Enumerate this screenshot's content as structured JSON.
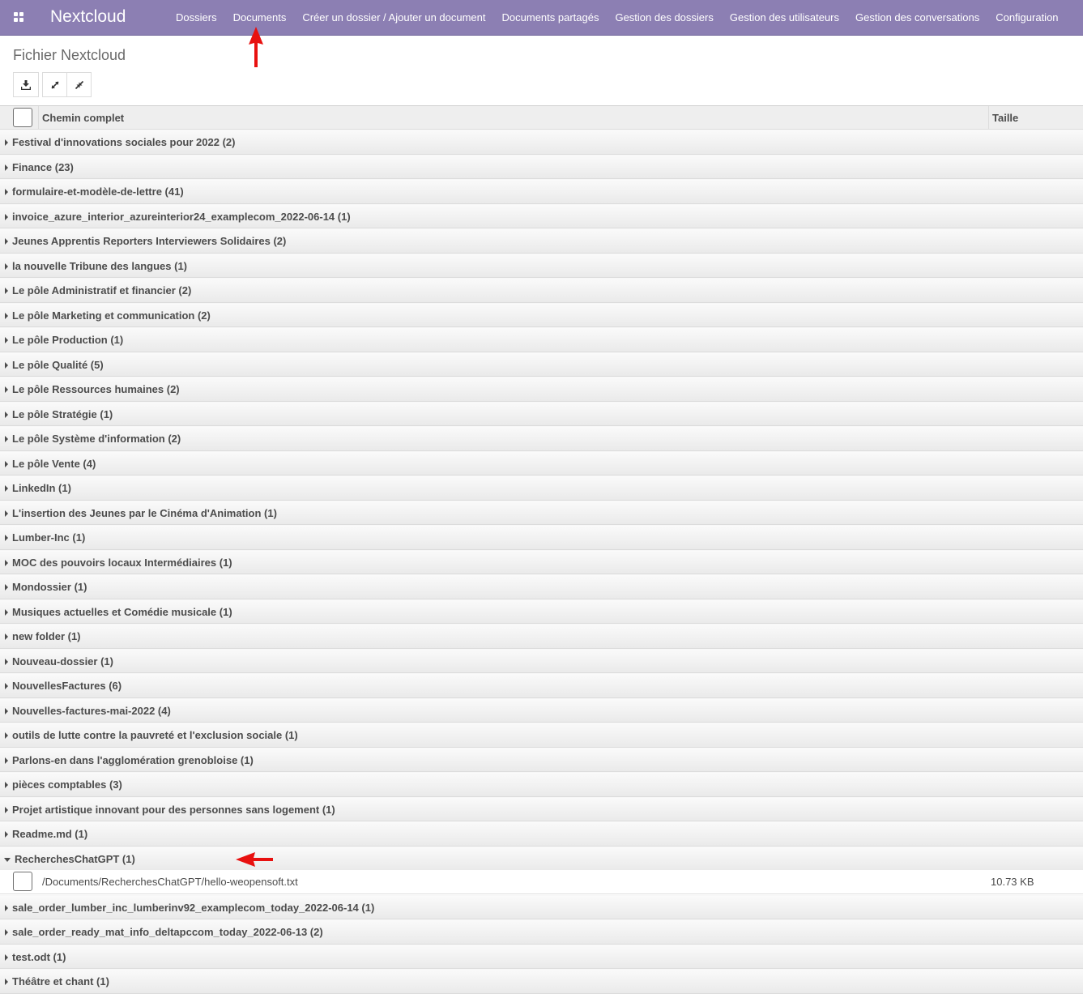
{
  "app": {
    "brand": "Nextcloud"
  },
  "menu": [
    "Dossiers",
    "Documents",
    "Créer un dossier / Ajouter un document",
    "Documents partagés",
    "Gestion des dossiers",
    "Gestion des utilisateurs",
    "Gestion des conversations",
    "Configuration"
  ],
  "page": {
    "title": "Fichier Nextcloud"
  },
  "toolbar": {
    "download_icon": "download-icon",
    "expand_icon": "expand-icon",
    "collapse_icon": "collapse-icon"
  },
  "table": {
    "headers": {
      "path": "Chemin complet",
      "size": "Taille"
    },
    "groups_before": [
      "Festival d'innovations sociales pour 2022 (2)",
      "Finance (23)",
      "formulaire-et-modèle-de-lettre (41)",
      "invoice_azure_interior_azureinterior24_examplecom_2022-06-14 (1)",
      "Jeunes Apprentis Reporters Interviewers Solidaires (2)",
      "la nouvelle Tribune des langues (1)",
      "Le pôle Administratif et financier (2)",
      "Le pôle Marketing et communication (2)",
      "Le pôle Production (1)",
      "Le pôle Qualité (5)",
      "Le pôle Ressources humaines (2)",
      "Le pôle Stratégie (1)",
      "Le pôle Système d'information (2)",
      "Le pôle Vente (4)",
      "LinkedIn (1)",
      "L'insertion des Jeunes par le Cinéma d'Animation (1)",
      "Lumber-Inc (1)",
      "MOC des pouvoirs locaux Intermédiaires (1)",
      "Mondossier (1)",
      "Musiques actuelles et Comédie musicale (1)",
      "new folder (1)",
      "Nouveau-dossier (1)",
      "NouvellesFactures (6)",
      "Nouvelles-factures-mai-2022 (4)",
      "outils de lutte contre la pauvreté et l'exclusion sociale (1)",
      "Parlons-en dans l'agglomération grenobloise (1)",
      "pièces comptables (3)",
      "Projet artistique innovant pour des personnes sans logement (1)",
      "Readme.md (1)"
    ],
    "open_group": {
      "label": "RecherchesChatGPT (1)",
      "records": [
        {
          "path": "/Documents/RecherchesChatGPT/hello-weopensoft.txt",
          "size": "10.73 KB"
        }
      ]
    },
    "groups_after": [
      "sale_order_lumber_inc_lumberinv92_examplecom_today_2022-06-14 (1)",
      "sale_order_ready_mat_info_deltapccom_today_2022-06-13 (2)",
      "test.odt (1)",
      "Théâtre et chant (1)"
    ]
  },
  "annotations": {
    "arrow_color": "#e8100f"
  },
  "colors": {
    "navbar": "#8c7fb3"
  }
}
